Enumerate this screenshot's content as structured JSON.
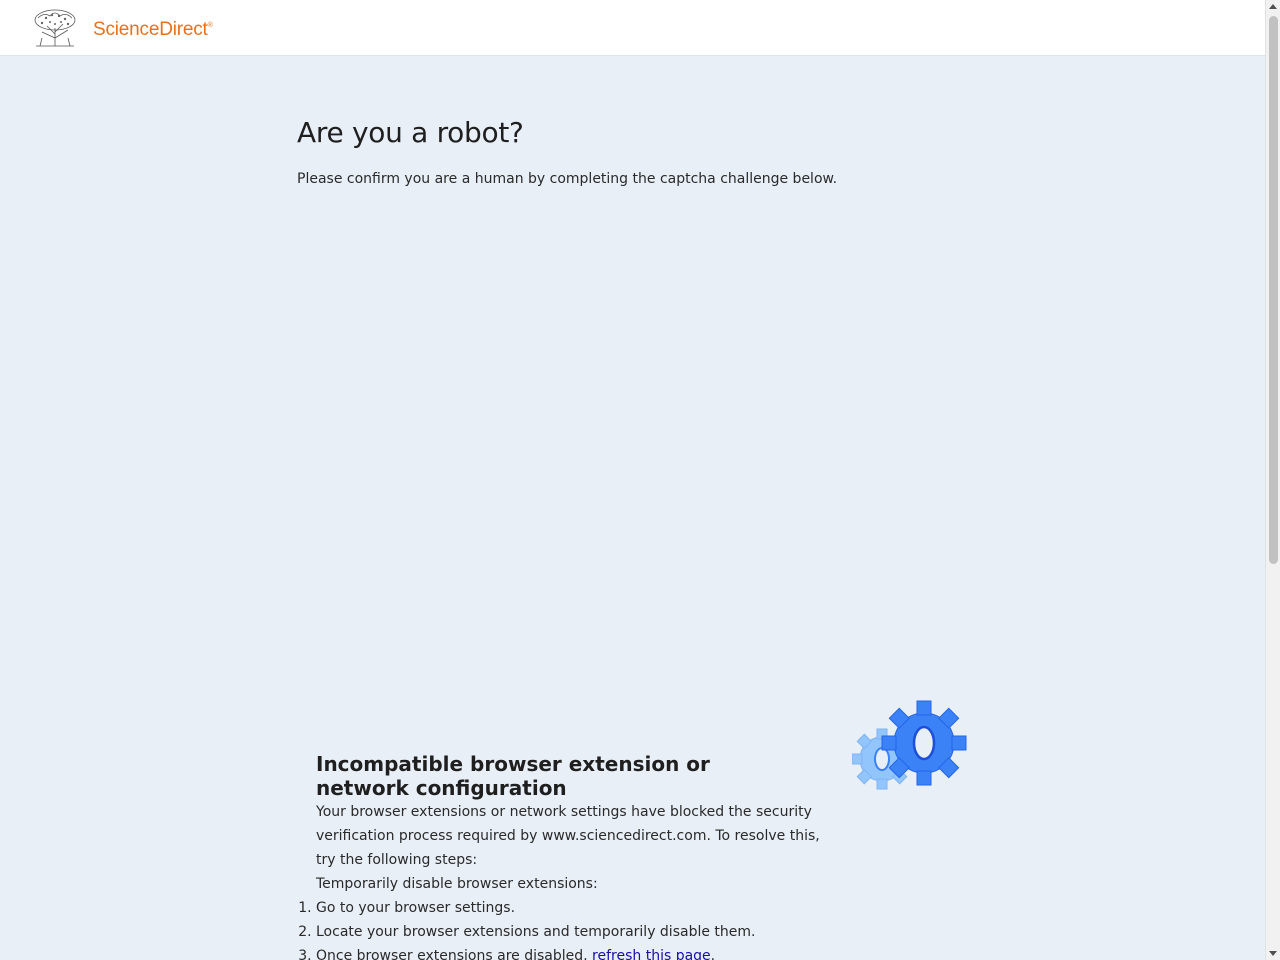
{
  "header": {
    "brand_name": "ScienceDirect",
    "brand_mark": "®",
    "logo_icon": "elsevier-tree-icon",
    "brand_color": "#e9711c"
  },
  "main": {
    "title": "Are you a robot?",
    "subtitle": "Please confirm you are a human by completing the captcha challenge below."
  },
  "error_panel": {
    "icon": "gears-icon",
    "heading": "Incompatible browser extension or network configuration",
    "body": "Your browser extensions or network settings have blocked the security verification process required by www.sciencedirect.com. To resolve this, try the following steps:",
    "sub_heading": "Temporarily disable browser extensions:",
    "steps": [
      "Go to your browser settings.",
      "Locate your browser extensions and temporarily disable them."
    ],
    "step3_prefix": "Once browser extensions are disabled, ",
    "step3_link": "refresh this page",
    "step3_suffix": "."
  },
  "colors": {
    "page_background": "#e8eff7",
    "header_background": "#ffffff",
    "link": "#1a0dab",
    "gear_primary": "#3b82f6",
    "gear_secondary": "#93c5fd"
  }
}
